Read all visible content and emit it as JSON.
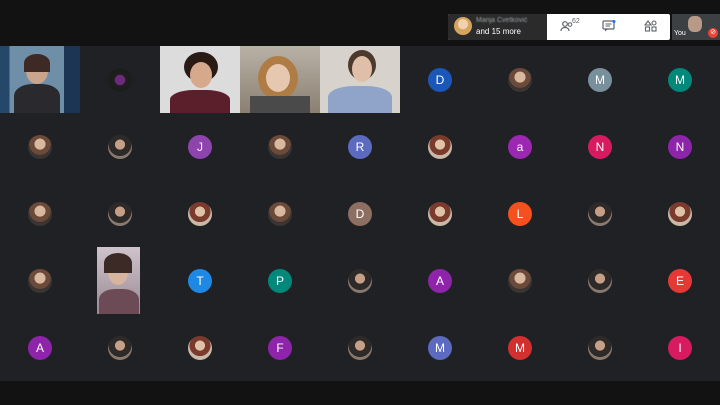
{
  "panel": {
    "blurred_name": "Marija Cvetković",
    "more_text": "and 15 more",
    "people_count": "62",
    "icons": [
      "people-icon",
      "chat-icon",
      "activities-icon"
    ]
  },
  "self_view": {
    "label": "You"
  },
  "tiles": [
    {
      "id": "r1c1",
      "type": "video"
    },
    {
      "id": "r1c2",
      "type": "photo"
    },
    {
      "id": "r1c3",
      "type": "video"
    },
    {
      "id": "r1c4",
      "type": "video"
    },
    {
      "id": "r1c5",
      "type": "video"
    },
    {
      "id": "r1c6",
      "type": "letter",
      "letter": "D",
      "color": "#1a57b8"
    },
    {
      "id": "r1c7",
      "type": "photo"
    },
    {
      "id": "r1c8",
      "type": "letter",
      "letter": "M",
      "color": "#78909c"
    },
    {
      "id": "r1c9",
      "type": "letter",
      "letter": "M",
      "color": "#00897b"
    },
    {
      "id": "r2c1",
      "type": "photo"
    },
    {
      "id": "r2c2",
      "type": "photo"
    },
    {
      "id": "r2c3",
      "type": "letter",
      "letter": "J",
      "color": "#8e44ad"
    },
    {
      "id": "r2c4",
      "type": "photo"
    },
    {
      "id": "r2c5",
      "type": "letter",
      "letter": "R",
      "color": "#5c6bc0"
    },
    {
      "id": "r2c6",
      "type": "photo"
    },
    {
      "id": "r2c7",
      "type": "letter",
      "letter": "a",
      "color": "#9c27b0"
    },
    {
      "id": "r2c8",
      "type": "letter",
      "letter": "N",
      "color": "#d81b60"
    },
    {
      "id": "r2c9",
      "type": "letter",
      "letter": "N",
      "color": "#8e24aa"
    },
    {
      "id": "r3c1",
      "type": "photo"
    },
    {
      "id": "r3c2",
      "type": "photo"
    },
    {
      "id": "r3c3",
      "type": "photo"
    },
    {
      "id": "r3c4",
      "type": "photo"
    },
    {
      "id": "r3c5",
      "type": "letter",
      "letter": "D",
      "color": "#8d6e63"
    },
    {
      "id": "r3c6",
      "type": "photo"
    },
    {
      "id": "r3c7",
      "type": "letter",
      "letter": "L",
      "color": "#f4511e"
    },
    {
      "id": "r3c8",
      "type": "photo"
    },
    {
      "id": "r3c9",
      "type": "photo"
    },
    {
      "id": "r4c1",
      "type": "photo"
    },
    {
      "id": "r4c2",
      "type": "video"
    },
    {
      "id": "r4c3",
      "type": "letter",
      "letter": "T",
      "color": "#1e88e5"
    },
    {
      "id": "r4c4",
      "type": "letter",
      "letter": "P",
      "color": "#00897b"
    },
    {
      "id": "r4c5",
      "type": "photo"
    },
    {
      "id": "r4c6",
      "type": "letter",
      "letter": "A",
      "color": "#8e24aa"
    },
    {
      "id": "r4c7",
      "type": "photo"
    },
    {
      "id": "r4c8",
      "type": "photo"
    },
    {
      "id": "r4c9",
      "type": "letter",
      "letter": "E",
      "color": "#e53935"
    },
    {
      "id": "r5c1",
      "type": "letter",
      "letter": "A",
      "color": "#8e24aa"
    },
    {
      "id": "r5c2",
      "type": "photo"
    },
    {
      "id": "r5c3",
      "type": "photo"
    },
    {
      "id": "r5c4",
      "type": "letter",
      "letter": "F",
      "color": "#8e24aa"
    },
    {
      "id": "r5c5",
      "type": "photo"
    },
    {
      "id": "r5c6",
      "type": "letter",
      "letter": "M",
      "color": "#5c6bc0"
    },
    {
      "id": "r5c7",
      "type": "letter",
      "letter": "M",
      "color": "#d32f2f"
    },
    {
      "id": "r5c8",
      "type": "photo"
    },
    {
      "id": "r5c9",
      "type": "letter",
      "letter": "I",
      "color": "#d81b60"
    }
  ]
}
